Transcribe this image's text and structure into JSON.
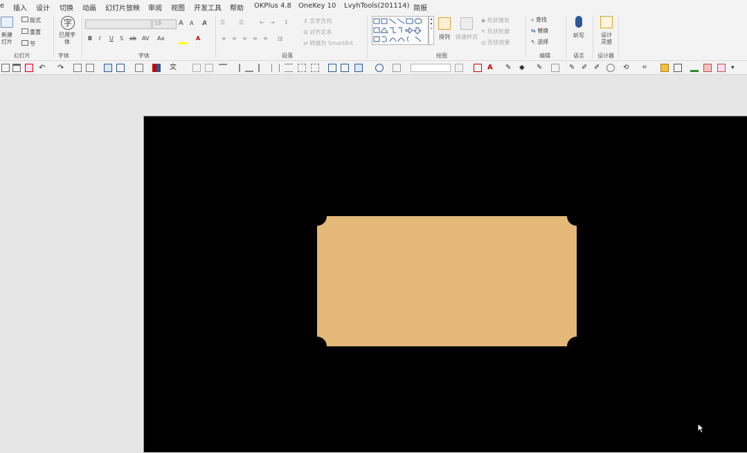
{
  "menu": [
    "e",
    "插入",
    "设计",
    "切换",
    "动画",
    "幻灯片放映",
    "审阅",
    "视图",
    "开发工具",
    "帮助",
    "OKPlus 4.8",
    "OneKey 10",
    "LvyhTools(201114)",
    "简报"
  ],
  "ribbon": {
    "slides": {
      "new_slide": [
        "新建",
        "灯片"
      ],
      "layout": "版式",
      "reset": "重置",
      "section": "节",
      "group": "幻灯片"
    },
    "font_tool": {
      "label": [
        "已用字",
        "体"
      ],
      "group": "字体"
    },
    "font": {
      "font_size": "18",
      "group": "字体",
      "bold": "B",
      "italic": "I",
      "underline": "U",
      "shadow": "S",
      "strike": "ab",
      "case": "Aa",
      "spacing": "AV",
      "grow": "A",
      "shrink": "A"
    },
    "paragraph": {
      "text_direction": "文字方向",
      "align_text": "对齐文本",
      "smartart": "转换为 SmartArt",
      "group": "段落"
    },
    "drawing": {
      "arrange": "排列",
      "quick_styles": "快速样式",
      "shape_fill": "形状填充",
      "shape_outline": "形状轮廓",
      "shape_effects": "形状效果",
      "group": "绘图"
    },
    "editing": {
      "find": "查找",
      "replace": "替换",
      "select": "选择",
      "group": "编辑"
    },
    "voice": {
      "dictate": "听写",
      "group": "语言"
    },
    "designer": {
      "label": [
        "设计",
        "灵感"
      ],
      "group": "设计器"
    }
  },
  "colors": {
    "slide_bg": "#000000",
    "shape_fill": "#E3B878",
    "ribbon_bg": "#f3f3f3",
    "canvas_bg": "#e6e6e6",
    "accent": "#2b5797"
  },
  "icons": [
    "save-icon",
    "open-icon",
    "undo-icon",
    "redo-icon",
    "cursor-icon"
  ]
}
